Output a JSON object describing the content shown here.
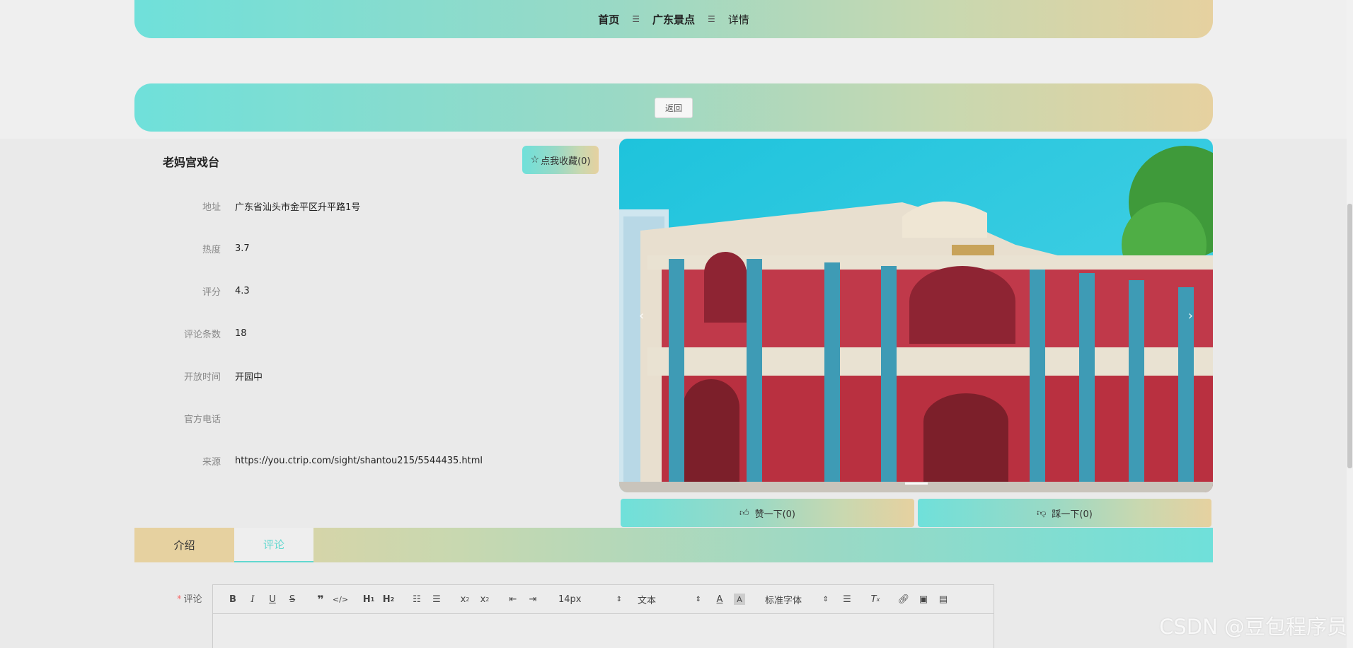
{
  "breadcrumb": {
    "home": "首页",
    "category": "广东景点",
    "current": "详情",
    "separator": "☰"
  },
  "back_button": "返回",
  "spot": {
    "name": "老妈宫戏台",
    "favorite_label": "点我收藏(0)",
    "fields": [
      {
        "label": "地址",
        "value": "广东省汕头市金平区升平路1号"
      },
      {
        "label": "热度",
        "value": "3.7"
      },
      {
        "label": "评分",
        "value": "4.3"
      },
      {
        "label": "评论条数",
        "value": "18"
      },
      {
        "label": "开放时间",
        "value": "开园中"
      },
      {
        "label": "官方电话",
        "value": ""
      },
      {
        "label": "来源",
        "value": "https://you.ctrip.com/sight/shantou215/5544435.html"
      }
    ]
  },
  "carousel": {
    "prev": "‹",
    "next": "›"
  },
  "votes": {
    "like": "赞一下(0)",
    "dislike": "踩一下(0)"
  },
  "tabs": {
    "intro": "介绍",
    "comment": "评论"
  },
  "comment_form": {
    "label": "评论",
    "required_mark": "*",
    "font_size": "14px",
    "text_type": "文本",
    "font_family": "标准字体"
  },
  "watermark": "CSDN @豆包程序员",
  "colors": {
    "accent": "#6fe0da",
    "warm": "#e6d1a0",
    "tab_active": "#62d8d0"
  }
}
